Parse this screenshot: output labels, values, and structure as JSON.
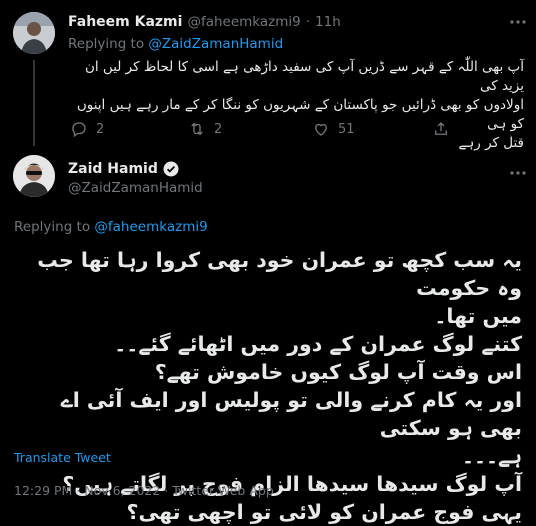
{
  "reply_tweet": {
    "author_name": "Faheem Kazmi",
    "author_handle": "@faheemkazmi9",
    "separator": "·",
    "time": "11h",
    "replying_prefix": "Replying to",
    "replying_to": "@ZaidZamanHamid",
    "text_lines": [
      "آپ بھی اللّٰہ کے قہر سے ڈریں آپ کی سفید داڑھی ہے اسی کا لحاظ کر لیں ان یزید کی",
      "اولادوں کو بھی ڈرائیں جو پاکستان کے شہریوں کو ننگا کر کے مار رہے ہیں اپنوں کو ہی",
      "قتل کر رہے"
    ],
    "reply_count": "2",
    "retweet_count": "2",
    "like_count": "51",
    "icons": [
      "reply-icon",
      "retweet-icon",
      "like-icon",
      "share-icon",
      "more-icon"
    ]
  },
  "main_tweet": {
    "author_name": "Zaid Hamid",
    "author_handle": "@ZaidZamanHamid",
    "verified": true,
    "replying_prefix": "Replying to",
    "replying_to": "@faheemkazmi9",
    "text_lines": [
      "یہ سب کچھ تو عمران خود بھی کروا رہا تھا جب وہ حکومت",
      "میں تھا۔",
      "کتنے لوگ عمران کے دور میں اٹھائے گئے۔۔",
      "اس وقت آپ لوگ کیوں خاموش تھے؟",
      "اور یہ کام کرنے والی تو پولیس اور ایف آئی اے بھی ہو سکتی",
      "ہے۔۔۔",
      "آپ لوگ سیدھا سیدھا الزام فوج پر لگاتے ہیں؟",
      "یہی فوج عمران کو لائی تو اچھی تھی؟"
    ],
    "translate_label": "Translate Tweet",
    "timestamp": "12:29 PM · Nov 6, 2022 · Twitter Web App"
  },
  "colors": {
    "background": "#000000",
    "text": "#e7e9ea",
    "muted": "#71767b",
    "accent": "#1d9bf0"
  }
}
